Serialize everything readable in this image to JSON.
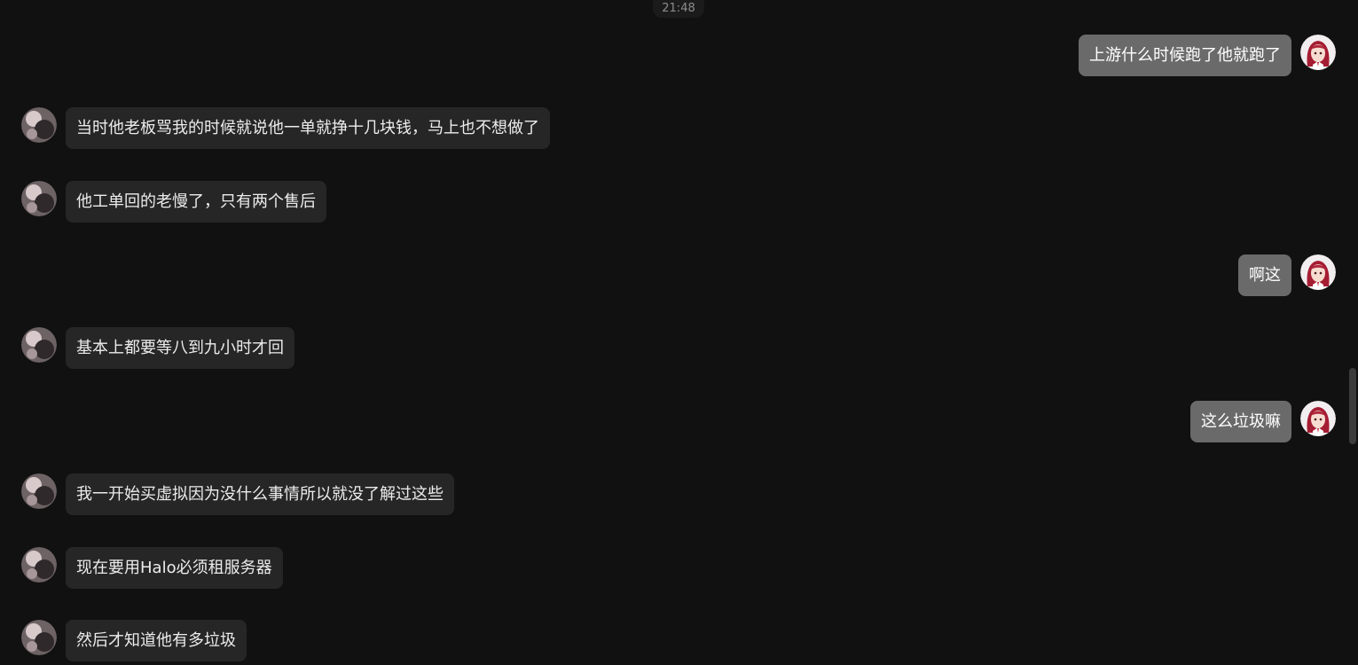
{
  "timestamp": "21:48",
  "messages": [
    {
      "side": "right",
      "text": "上游什么时候跑了他就跑了"
    },
    {
      "side": "left",
      "text": "当时他老板骂我的时候就说他一单就挣十几块钱，马上也不想做了"
    },
    {
      "side": "left",
      "text": "他工单回的老慢了，只有两个售后"
    },
    {
      "side": "right",
      "text": "啊这"
    },
    {
      "side": "left",
      "text": "基本上都要等八到九小时才回"
    },
    {
      "side": "right",
      "text": "这么垃圾嘛"
    },
    {
      "side": "left",
      "text": "我一开始买虚拟因为没什么事情所以就没了解过这些"
    },
    {
      "side": "left",
      "text": "现在要用Halo必须租服务器"
    },
    {
      "side": "left",
      "text": "然后才知道他有多垃圾"
    }
  ],
  "colors": {
    "background": "#111111",
    "bubble_incoming": "#262626",
    "bubble_outgoing": "#6a6a6a"
  },
  "icons": {
    "self_avatar": "anime-girl-red-hair-avatar-icon",
    "contact_avatar": "photo-avatar-icon"
  }
}
